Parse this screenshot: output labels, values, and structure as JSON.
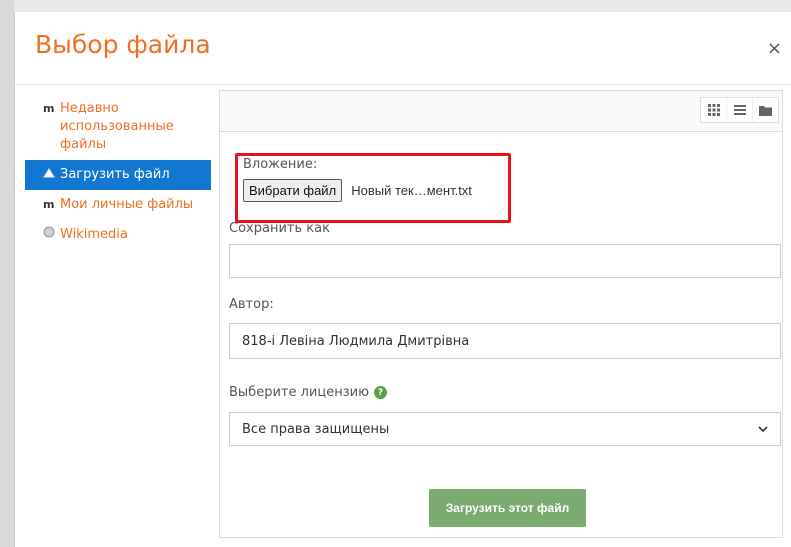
{
  "modal": {
    "title": "Выбор файла",
    "close_glyph": "×"
  },
  "sidebar": {
    "items": [
      {
        "icon": "moodle-icon",
        "label": "Недавно использованные файлы"
      },
      {
        "icon": "upload-icon",
        "label": "Загрузить файл",
        "active": true
      },
      {
        "icon": "moodle-icon",
        "label": "Мои личные файлы"
      },
      {
        "icon": "wikimedia-icon",
        "label": "Wikimedia"
      }
    ]
  },
  "form": {
    "attachment_label": "Вложение:",
    "choose_file_button": "Вибрати файл",
    "chosen_file_name": "Новый тек…мент.txt",
    "save_as_label": "Сохранить как",
    "save_as_value": "",
    "author_label": "Автор:",
    "author_value": "818-і Левіна Людмила Дмитрівна",
    "license_label": "Выберите лицензию",
    "license_value": "Все права защищены",
    "upload_button": "Загрузить этот файл"
  },
  "colors": {
    "accent": "#f26f21",
    "active_nav": "#1177d1",
    "upload_button": "#79ac6e",
    "highlight_border": "#e8131a"
  }
}
